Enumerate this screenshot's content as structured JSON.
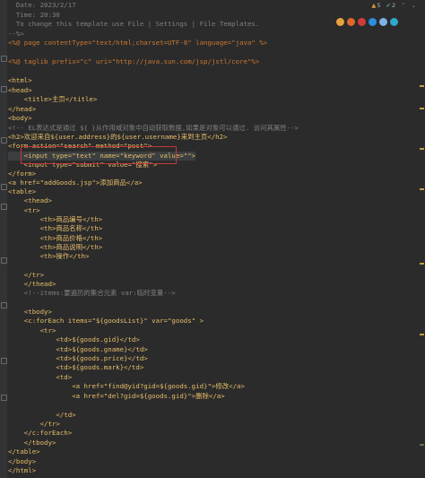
{
  "editor": {
    "lines": [
      {
        "n": "l1",
        "text": "  Date: 2023/2/17"
      },
      {
        "n": "l2",
        "text": "  Time: 20:30"
      },
      {
        "n": "l3",
        "text": "  To change this template use File | Settings | File Templates."
      },
      {
        "n": "l4",
        "text": "--%>"
      },
      {
        "n": "l5",
        "text": "<%@ page contentType=\"text/html;charset=UTF-8\" language=\"java\" %>"
      },
      {
        "n": "l6",
        "text": ""
      },
      {
        "n": "l7",
        "text": "<%@ taglib prefix=\"c\" uri=\"http://java.sun.com/jsp/jstl/core\"%>"
      },
      {
        "n": "l8",
        "text": ""
      },
      {
        "n": "l9",
        "text": "<html>"
      },
      {
        "n": "l10",
        "text": "<head>"
      },
      {
        "n": "l11",
        "text": "    <title>主页</title>"
      },
      {
        "n": "l12",
        "text": "</head>"
      },
      {
        "n": "l13",
        "text": "<body>"
      },
      {
        "n": "l14",
        "text": "<!-- EL表达式是通过 ${ }从作用域对象中自动获取数据,如果是对象可以通过. 访问其属性-->"
      },
      {
        "n": "l15",
        "text": "<h2>欢迎来自${user.address}的${user.username}来到主页</h2>"
      },
      {
        "n": "l16",
        "text": "<form action=\"search\" method=\"post\">"
      },
      {
        "n": "l17",
        "text": "    <input type=\"text\" name=\"keyword\" value=\"\">"
      },
      {
        "n": "l18",
        "text": "    <input type=\"submit\" value=\"搜索\">"
      },
      {
        "n": "l19",
        "text": "</form>"
      },
      {
        "n": "l20",
        "text": "<a href=\"addGoods.jsp\">添加商品</a>"
      },
      {
        "n": "l21",
        "text": "<table>"
      },
      {
        "n": "l22",
        "text": "    <thead>"
      },
      {
        "n": "l23",
        "text": "    <tr>"
      },
      {
        "n": "l24",
        "text": "        <th>商品编号</th>"
      },
      {
        "n": "l25",
        "text": "        <th>商品名称</th>"
      },
      {
        "n": "l26",
        "text": "        <th>商品价格</th>"
      },
      {
        "n": "l27",
        "text": "        <th>商品说明</th>"
      },
      {
        "n": "l28",
        "text": "        <th>操作</th>"
      },
      {
        "n": "l29",
        "text": ""
      },
      {
        "n": "l30",
        "text": "    </tr>"
      },
      {
        "n": "l31",
        "text": "    </thead>"
      },
      {
        "n": "l32",
        "text": "    <!--items:要遍历的集合元素 var:临时变量-->"
      },
      {
        "n": "l33",
        "text": ""
      },
      {
        "n": "l34",
        "text": "    <tbody>"
      },
      {
        "n": "l35",
        "text": "    <c:forEach items=\"${goodsList}\" var=\"goods\" >"
      },
      {
        "n": "l36",
        "text": "        <tr>"
      },
      {
        "n": "l37",
        "text": "            <td>${goods.gid}</td>"
      },
      {
        "n": "l38",
        "text": "            <td>${goods.gname}</td>"
      },
      {
        "n": "l39",
        "text": "            <td>${goods.price}</td>"
      },
      {
        "n": "l40",
        "text": "            <td>${goods.mark}</td>"
      },
      {
        "n": "l41",
        "text": "            <td>"
      },
      {
        "n": "l42",
        "text": "                <a href=\"find@yid?gid=${goods.gid}\">修改</a>"
      },
      {
        "n": "l43",
        "text": "                <a href=\"del?gid=${goods.gid}\">删除</a>"
      },
      {
        "n": "l44",
        "text": ""
      },
      {
        "n": "l45",
        "text": "            </td>"
      },
      {
        "n": "l46",
        "text": "        </tr>"
      },
      {
        "n": "l47",
        "text": "    </c:forEach>"
      },
      {
        "n": "l48",
        "text": "    </tbody>"
      },
      {
        "n": "l49",
        "text": "</table>"
      },
      {
        "n": "l50",
        "text": "</body>"
      },
      {
        "n": "l51",
        "text": "</html>"
      }
    ]
  },
  "inspections": {
    "warnings": "5",
    "checks": "2"
  },
  "browsers": [
    {
      "name": "chrome-icon",
      "color": "#e8a33d"
    },
    {
      "name": "firefox-icon",
      "color": "#e0672a"
    },
    {
      "name": "opera-icon",
      "color": "#d23b3b"
    },
    {
      "name": "ie-icon",
      "color": "#2d8ee0"
    },
    {
      "name": "safari-icon",
      "color": "#7fb3e8"
    },
    {
      "name": "edge-icon",
      "color": "#2ea8c8"
    }
  ],
  "colors": {
    "background": "#2b2b2b",
    "highlight_box": "#c0393b"
  }
}
